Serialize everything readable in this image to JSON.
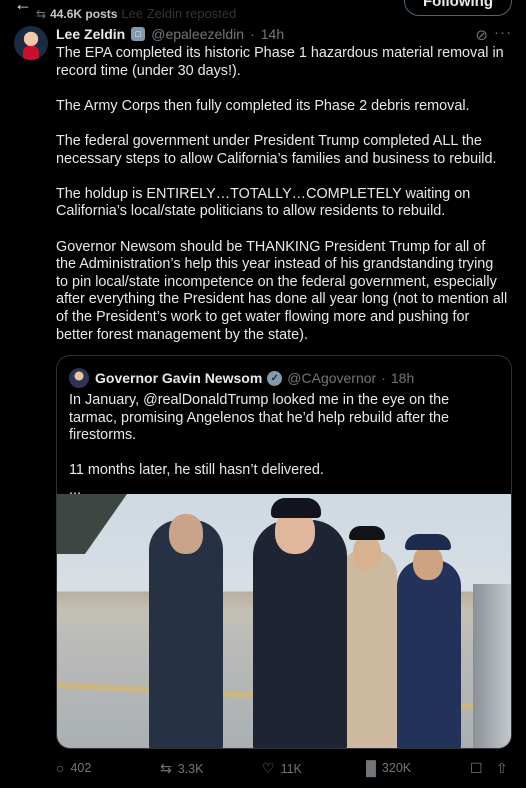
{
  "topbar": {
    "back_icon": "arrow-left-icon",
    "repost_icon": "repost-icon",
    "views_overlay": "44.6K posts",
    "reposted_label": "Lee Zeldin reposted",
    "follow_label": "Following"
  },
  "post": {
    "author_name": "Lee Zeldin",
    "badge": "government-badge",
    "handle": "@epaleezeldin",
    "dot": "·",
    "time": "14h",
    "paragraphs": [
      "The EPA completed its historic Phase 1 hazardous material removal in record time (under 30 days!).",
      "The Army Corps then fully completed its Phase 2 debris removal.",
      "The federal government under President Trump completed ALL the necessary steps to allow California’s families and business to rebuild.",
      "The holdup is ENTIRELY…TOTALLY…COMPLETELY waiting on California’s local/state politicians to allow residents to rebuild.",
      "Governor Newsom should be THANKING President Trump for all of the Administration’s help this year instead of his grandstanding trying to pin local/state incompetence on the federal government, especially after everything the President has done all year long (not to mention all of the President’s work to get water flowing more and pushing for better forest management by the state)."
    ]
  },
  "quote": {
    "author_name": "Governor Gavin Newsom",
    "handle": "@CAgovernor",
    "dot": "·",
    "time": "18h",
    "paragraphs": [
      "In January, @realDonaldTrump looked me in the eye on the tarmac, promising Angelenos that he’d help rebuild after the firestorms.",
      "11 months later, he still hasn’t delivered.",
      "..."
    ]
  },
  "actions": {
    "replies": "402",
    "reposts": "3.3K",
    "likes": "11K",
    "views": "320K"
  },
  "colors": {
    "background": "#000000",
    "text": "#e7e9ea",
    "muted": "#71767b",
    "border": "#2f3336"
  }
}
